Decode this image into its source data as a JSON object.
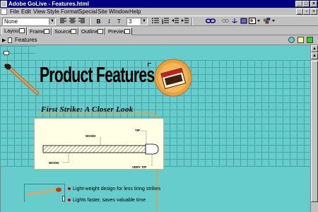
{
  "window": {
    "title": "Adobe GoLive - Features.html",
    "controls": {
      "minimize": "_",
      "maximize": "□",
      "close": "×"
    }
  },
  "menubar": {
    "items": [
      "File",
      "Edit",
      "View",
      "Style",
      "Format",
      "Special",
      "Site",
      "Window",
      "Help"
    ]
  },
  "toolbar": {
    "paragraph_format": "None",
    "bold": "B",
    "italic": "I",
    "teletype": "T",
    "font_size": "3"
  },
  "tabs": [
    {
      "label": "Layout",
      "active": true
    },
    {
      "label": "Frames",
      "active": false
    },
    {
      "label": "Source",
      "active": false
    },
    {
      "label": "Outline",
      "active": false
    },
    {
      "label": "Preview",
      "active": false
    }
  ],
  "document": {
    "title": "Features"
  },
  "page": {
    "heading": "Product Features",
    "subheading": "First Strike: A Closer Look",
    "logo_text": "First Strike",
    "diagram_labels": {
      "wood_top": "WOOD",
      "wood_bottom": "WOOD",
      "tip": "TIP",
      "very_tip": "VERY TIP"
    },
    "features": [
      "Light-weight design for less tiring strikes",
      "Lights faster, saves valuable time"
    ]
  },
  "colors": {
    "title_bar": "#000080",
    "chrome": "#c0c0c0",
    "canvas_bg": "#66cccc",
    "grid_line": "#4aa6a6",
    "diagram_bg": "#ffffe6",
    "accent_orange": "#e8a040",
    "bullet_red": "#cc0000"
  }
}
